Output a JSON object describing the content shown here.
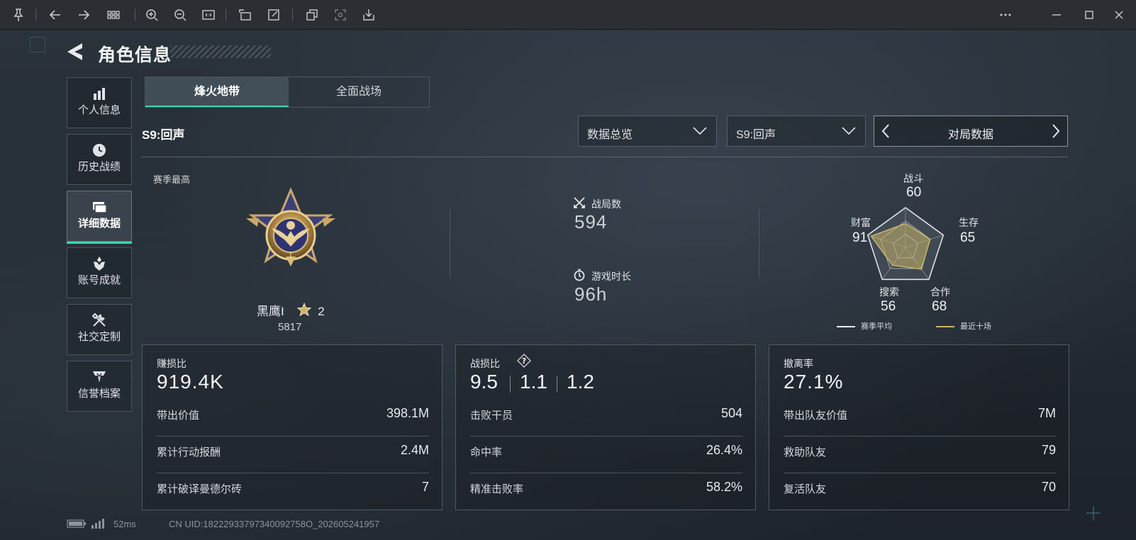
{
  "header": {
    "title": "角色信息"
  },
  "sidebar": {
    "items": [
      {
        "label": "个人信息",
        "icon": "bar-chart-icon"
      },
      {
        "label": "历史战绩",
        "icon": "clock-icon"
      },
      {
        "label": "详细数据",
        "icon": "cards-icon",
        "active": true
      },
      {
        "label": "账号成就",
        "icon": "achievement-icon"
      },
      {
        "label": "社交定制",
        "icon": "tools-icon"
      },
      {
        "label": "信誉档案",
        "icon": "credit-shield-icon"
      }
    ]
  },
  "mode_tabs": [
    {
      "label": "烽火地带",
      "active": true
    },
    {
      "label": "全面战场",
      "active": false
    }
  ],
  "season": {
    "label": "S9:回声"
  },
  "filters": {
    "overview": "数据总览",
    "season": "S9:回声",
    "match_data": "对局数据"
  },
  "rank": {
    "section_label": "赛季最高",
    "name": "黑鹰I",
    "stars": "2",
    "score": "5817"
  },
  "stats": {
    "matches_label": "战局数",
    "matches_value": "594",
    "playtime_label": "游戏时长",
    "playtime_value": "96h"
  },
  "radar": {
    "combat_label": "战斗",
    "combat_value": "60",
    "survival_label": "生存",
    "survival_value": "65",
    "teamwork_label": "合作",
    "teamwork_value": "68",
    "search_label": "搜索",
    "search_value": "56",
    "wealth_label": "财富",
    "wealth_value": "91",
    "legend_season": "赛季平均",
    "legend_recent": "最近十场",
    "season_avg_color": "#e8ecef",
    "recent_color": "#c9b46a",
    "recent_values": [
      60,
      65,
      68,
      56,
      91
    ]
  },
  "cards": {
    "profit": {
      "label": "赚损比",
      "value": "919.4K",
      "rows": [
        {
          "k": "带出价值",
          "v": "398.1M"
        },
        {
          "k": "累计行动报酬",
          "v": "2.4M"
        },
        {
          "k": "累计破译曼德尔砖",
          "v": "7"
        }
      ]
    },
    "kd": {
      "label": "战损比",
      "help": "?",
      "values": [
        "9.5",
        "1.1",
        "1.2"
      ],
      "rows": [
        {
          "k": "击败干员",
          "v": "504"
        },
        {
          "k": "命中率",
          "v": "26.4%"
        },
        {
          "k": "精准击败率",
          "v": "58.2%"
        }
      ]
    },
    "extract": {
      "label": "撤离率",
      "value": "27.1%",
      "rows": [
        {
          "k": "带出队友价值",
          "v": "7M"
        },
        {
          "k": "救助队友",
          "v": "79"
        },
        {
          "k": "复活队友",
          "v": "70"
        }
      ]
    }
  },
  "footer": {
    "ping": "52ms",
    "uid": "CN UID:18222933797340092758O_202605241957"
  },
  "colors": {
    "accent": "#3fd6a4",
    "gold": "#c9b46a"
  }
}
